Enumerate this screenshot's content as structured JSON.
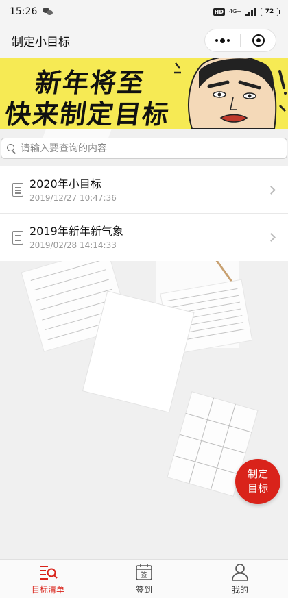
{
  "status_bar": {
    "time": "15:26",
    "hd": "HD",
    "network": "4G+",
    "battery": "72"
  },
  "nav": {
    "title": "制定小目标"
  },
  "banner": {
    "line1": "新年将至",
    "line2": "快来制定目标"
  },
  "search": {
    "placeholder": "请输入要查询的内容",
    "value": ""
  },
  "goals": [
    {
      "title": "2020年小目标",
      "time": "2019/12/27 10:47:36"
    },
    {
      "title": "2019年新年新气象",
      "time": "2019/02/28 14:14:33"
    }
  ],
  "fab": {
    "line1": "制定",
    "line2": "目标"
  },
  "tabs": [
    {
      "label": "目标清单",
      "icon": "list-search-icon",
      "active": true
    },
    {
      "label": "签到",
      "icon": "calendar-sign-icon",
      "active": false
    },
    {
      "label": "我的",
      "icon": "user-icon",
      "active": false
    }
  ],
  "colors": {
    "accent": "#d9231a",
    "banner": "#f6ea54"
  }
}
